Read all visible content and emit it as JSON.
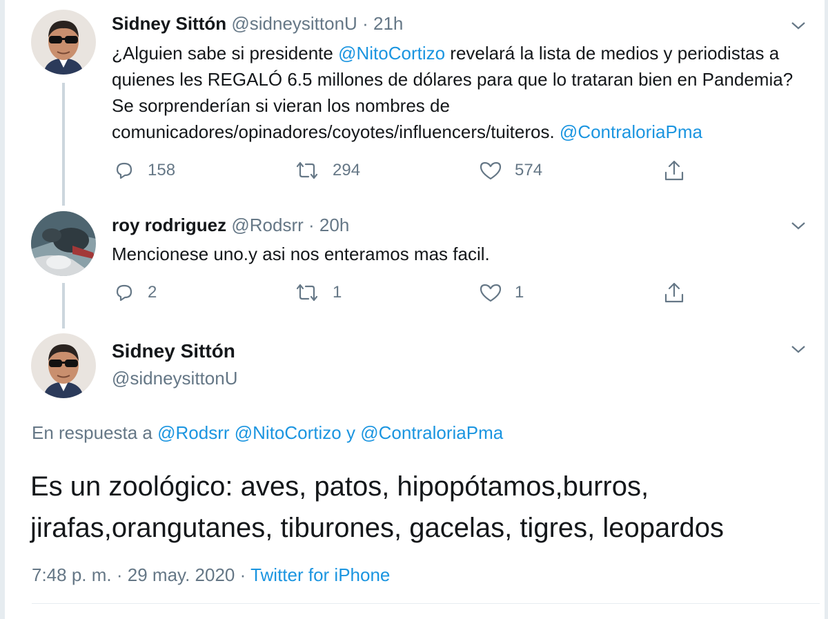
{
  "tweet1": {
    "name": "Sidney Sittón",
    "handle": "@sidneysittonU",
    "time": "21h",
    "text_part1": "¿Alguien sabe si presidente ",
    "mention1": "@NitoCortizo",
    "text_part2": " revelará la lista de medios y periodistas a quienes les REGALÓ 6.5 millones de dólares para que lo trataran bien en Pandemia? Se sorprenderían si vieran los nombres de comunicadores/opinadores/coyotes/influencers/tuiteros. ",
    "mention2": "@ContraloriaPma",
    "replies": "158",
    "retweets": "294",
    "likes": "574"
  },
  "tweet2": {
    "name": "roy rodriguez",
    "handle": "@Rodsrr",
    "time": "20h",
    "text": "Mencionese uno.y asi nos enteramos mas facil.",
    "replies": "2",
    "retweets": "1",
    "likes": "1"
  },
  "main_tweet": {
    "name": "Sidney Sittón",
    "handle": "@sidneysittonU",
    "reply_prefix": "En respuesta a ",
    "reply_mention1": "@Rodsrr",
    "reply_mention2": "@NitoCortizo",
    "reply_and": " y ",
    "reply_mention3": "@ContraloriaPma",
    "text": "Es un zoológico: aves, patos, hipopótamos,burros, jirafas,orangutanes, tiburones, gacelas, tigres, leopardos",
    "time": "7:48 p. m.",
    "date": "29 may. 2020",
    "source": "Twitter for iPhone"
  },
  "separator": "·",
  "icons": {
    "reply": "reply-icon",
    "retweet": "retweet-icon",
    "like": "heart-icon",
    "share": "share-icon",
    "caret": "chevron-down-icon"
  },
  "colors": {
    "link": "#1b95e0",
    "secondary": "#657786",
    "primary": "#14171a",
    "thread_line": "#ccd6dd"
  }
}
